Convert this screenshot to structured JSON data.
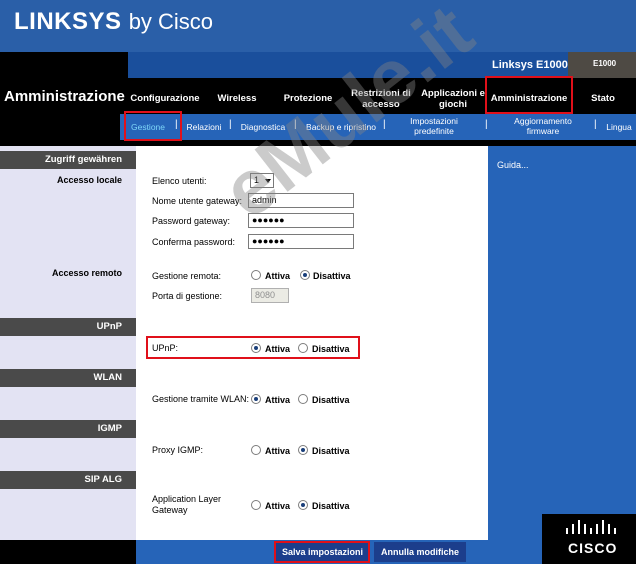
{
  "brand": {
    "logo": "LINKSYS",
    "by": "by Cisco"
  },
  "model": {
    "name": "Linksys E1000",
    "short": "E1000"
  },
  "section_title": "Amministrazione",
  "nav": {
    "items": [
      {
        "label": "Configurazione"
      },
      {
        "label": "Wireless"
      },
      {
        "label": "Protezione"
      },
      {
        "label": "Restrizioni di accesso"
      },
      {
        "label": "Applicazioni e giochi"
      },
      {
        "label": "Amministrazione",
        "active": true
      },
      {
        "label": "Stato"
      }
    ]
  },
  "subnav": {
    "items": [
      {
        "label": "Gestione",
        "active": true
      },
      {
        "label": "Relazioni"
      },
      {
        "label": "Diagnostica"
      },
      {
        "label": "Backup e ripristino"
      },
      {
        "label": "Impostazioni predefinite"
      },
      {
        "label": "Aggiornamento firmware"
      },
      {
        "label": "Lingua"
      }
    ],
    "separator": "|"
  },
  "left": {
    "sections": [
      {
        "title": "Zugriff gewähren"
      },
      {
        "title": "UPnP"
      },
      {
        "title": "WLAN"
      },
      {
        "title": "IGMP"
      },
      {
        "title": "SIP ALG"
      }
    ],
    "labels": {
      "local": "Accesso locale",
      "remote": "Accesso remoto"
    }
  },
  "form": {
    "user_list": {
      "label": "Elenco utenti:",
      "value": "1"
    },
    "gateway_user": {
      "label": "Nome utente gateway:",
      "value": "admin"
    },
    "gateway_password": {
      "label": "Password gateway:",
      "value": "●●●●●●"
    },
    "confirm_password": {
      "label": "Conferma password:",
      "value": "●●●●●●"
    },
    "remote_mgmt": {
      "label": "Gestione remota:",
      "on": "Attiva",
      "off": "Disattiva",
      "selected": "off"
    },
    "mgmt_port": {
      "label": "Porta di gestione:",
      "value": "8080"
    },
    "upnp": {
      "label": "UPnP:",
      "on": "Attiva",
      "off": "Disattiva",
      "selected": "on"
    },
    "wlan_mgmt": {
      "label": "Gestione tramite WLAN:",
      "on": "Attiva",
      "off": "Disattiva",
      "selected": "on"
    },
    "igmp_proxy": {
      "label": "Proxy IGMP:",
      "on": "Attiva",
      "off": "Disattiva",
      "selected": "off"
    },
    "alg": {
      "label": "Application Layer Gateway",
      "on": "Attiva",
      "off": "Disattiva",
      "selected": "off"
    }
  },
  "help": {
    "link": "Guida..."
  },
  "footer": {
    "save": "Salva impostazioni",
    "cancel": "Annulla modifiche",
    "cisco": "CISCO"
  },
  "watermark": "eMule.it",
  "colors": {
    "header": "#2a5fa8",
    "subnav": "#2664b8",
    "highlight": "#e0101a",
    "active_sub": "#7ed6f8"
  }
}
